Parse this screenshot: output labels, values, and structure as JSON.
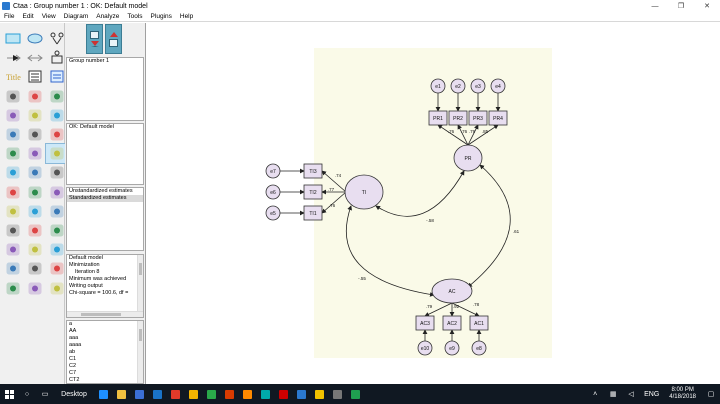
{
  "window": {
    "title": "Ctaa : Group number 1 : OK: Default model",
    "controls": [
      "—",
      "❐",
      "✕"
    ]
  },
  "menu": [
    "File",
    "Edit",
    "View",
    "Diagram",
    "Analyze",
    "Tools",
    "Plugins",
    "Help"
  ],
  "toolbox": {
    "tools": [
      "draw-observed-icon",
      "draw-unobserved-icon",
      "draw-indicator-icon",
      "single-arrow-icon",
      "double-arrow-icon",
      "unique-variable-icon",
      "title-icon",
      "list-variables-model-icon",
      "list-variables-dataset-icon",
      "select-one-icon",
      "select-all-icon",
      "deselect-all-icon",
      "duplicate-icon",
      "move-icon",
      "erase-icon",
      "change-shape-icon",
      "rotate-icon",
      "reflect-icon",
      "move-parameter-icon",
      "scroll-icon",
      "touch-up-icon",
      "data-files-icon",
      "analysis-properties-icon",
      "calculate-estimates-icon",
      "copy-clipboard-icon",
      "view-text-icon",
      "save-icon",
      "object-properties-icon",
      "drag-properties-icon",
      "preserve-symmetries-icon",
      "zoom-area-icon",
      "zoom-in-icon",
      "zoom-out-icon",
      "zoom-page-icon",
      "fit-page-icon",
      "loupe-icon",
      "degrees-freedom-icon",
      "multiple-group-icon",
      "print-icon",
      "undo-icon",
      "redo-icon",
      "specification-search-icon"
    ],
    "selected_index": 20
  },
  "side": {
    "groups": [
      "Group number 1"
    ],
    "models": [
      "OK: Default model"
    ],
    "estimates": [
      "Unstandardized estimates",
      "Standardized estimates"
    ],
    "estimates_selected": 1,
    "log": [
      "Default model",
      "Minimization",
      "Iteration 8",
      "Minimum was achieved",
      "Writing output",
      "Chi-square = 100.6, df ="
    ],
    "variables": [
      "a",
      "AA",
      "aaa",
      "aaaa",
      "ab",
      "C1",
      "C2",
      "C7",
      "CT2"
    ]
  },
  "diagram": {
    "latent": [
      {
        "id": "PR",
        "label": "PR"
      },
      {
        "id": "TI",
        "label": "TI"
      },
      {
        "id": "AC",
        "label": "AC"
      }
    ],
    "observed": [
      {
        "id": "PR1",
        "label": "PR1"
      },
      {
        "id": "PR2",
        "label": "PR2"
      },
      {
        "id": "PR3",
        "label": "PR3"
      },
      {
        "id": "PR4",
        "label": "PR4"
      },
      {
        "id": "TI3",
        "label": "TI3"
      },
      {
        "id": "TI2",
        "label": "TI2"
      },
      {
        "id": "TI1",
        "label": "TI1"
      },
      {
        "id": "AC3",
        "label": "AC3"
      },
      {
        "id": "AC2",
        "label": "AC2"
      },
      {
        "id": "AC1",
        "label": "AC1"
      }
    ],
    "errors": [
      {
        "id": "e1",
        "label": "e1"
      },
      {
        "id": "e2",
        "label": "e2"
      },
      {
        "id": "e3",
        "label": "e3"
      },
      {
        "id": "e4",
        "label": "e4"
      },
      {
        "id": "e7",
        "label": "e7"
      },
      {
        "id": "e6",
        "label": "e6"
      },
      {
        "id": "e5",
        "label": "e5"
      },
      {
        "id": "e10",
        "label": "e10"
      },
      {
        "id": "e9",
        "label": "e9"
      },
      {
        "id": "e8",
        "label": "e8"
      }
    ],
    "loadings": {
      "PR1": ".76",
      "PR2": ".76",
      "PR3": ".79",
      "PR4": ".85",
      "TI3": ".74",
      "TI2": ".77",
      "TI1": ".76",
      "AC3": ".79",
      "AC2": ".92",
      "AC1": ".78"
    },
    "correlations": {
      "PR_TI": "-.58",
      "PR_AC": ".61",
      "TI_AC": "-.55"
    }
  },
  "taskbar": {
    "desktop_label": "Desktop",
    "language": "ENG",
    "time": "8:00 PM",
    "date": "4/18/2018",
    "icon_colors": [
      "#1e90ff",
      "#f0c040",
      "#3b6fd6",
      "#1a73c8",
      "#e03a2a",
      "#f5b400",
      "#2aa84a",
      "#d83b01",
      "#ff8a00",
      "#0aa",
      "#c00",
      "#2b79d0",
      "#f2c200",
      "#777",
      "#1fa050"
    ]
  },
  "colors": {
    "latent_fill": "#e8def0",
    "observed_fill": "#e8def0",
    "diagram_bg": "#fafae8",
    "accent": "#5fa7bf"
  }
}
